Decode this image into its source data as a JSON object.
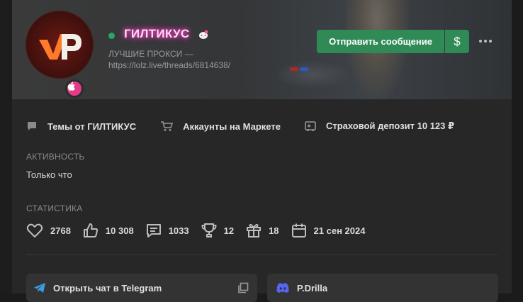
{
  "profile": {
    "username": "ГИЛТИКУС",
    "title_line1": "ЛУЧШИЕ ПРОКСИ —",
    "title_line2": "https://lolz.live/threads/6814638/",
    "avatar_text": "VP",
    "online": true
  },
  "actions": {
    "message_label": "Отправить сообщение",
    "money_icon": "$",
    "more_icon": "•••"
  },
  "links": [
    {
      "label": "Темы от ГИЛТИКУС",
      "icon": "chat-bubble-icon"
    },
    {
      "label": "Аккаунты на Маркете",
      "icon": "cart-icon"
    },
    {
      "label": "Страховой депозит 10 123 ₽",
      "icon": "deposit-icon"
    }
  ],
  "activity": {
    "label": "АКТИВНОСТЬ",
    "value": "Только что"
  },
  "stats": {
    "label": "СТАТИСТИКА",
    "items": [
      {
        "icon": "heart-icon",
        "value": "2768"
      },
      {
        "icon": "like-icon",
        "value": "10 308"
      },
      {
        "icon": "message-icon",
        "value": "1033"
      },
      {
        "icon": "trophy-icon",
        "value": "12"
      },
      {
        "icon": "gift-icon",
        "value": "18"
      },
      {
        "icon": "calendar-icon",
        "value": "21 сен 2024"
      }
    ]
  },
  "contacts": {
    "telegram_label": "Открыть чат в Telegram",
    "discord_label": "P.Drilla"
  },
  "colors": {
    "accent_green": "#2f8a55",
    "online": "#2aa46a",
    "username_glow": "#ff3fc7"
  }
}
